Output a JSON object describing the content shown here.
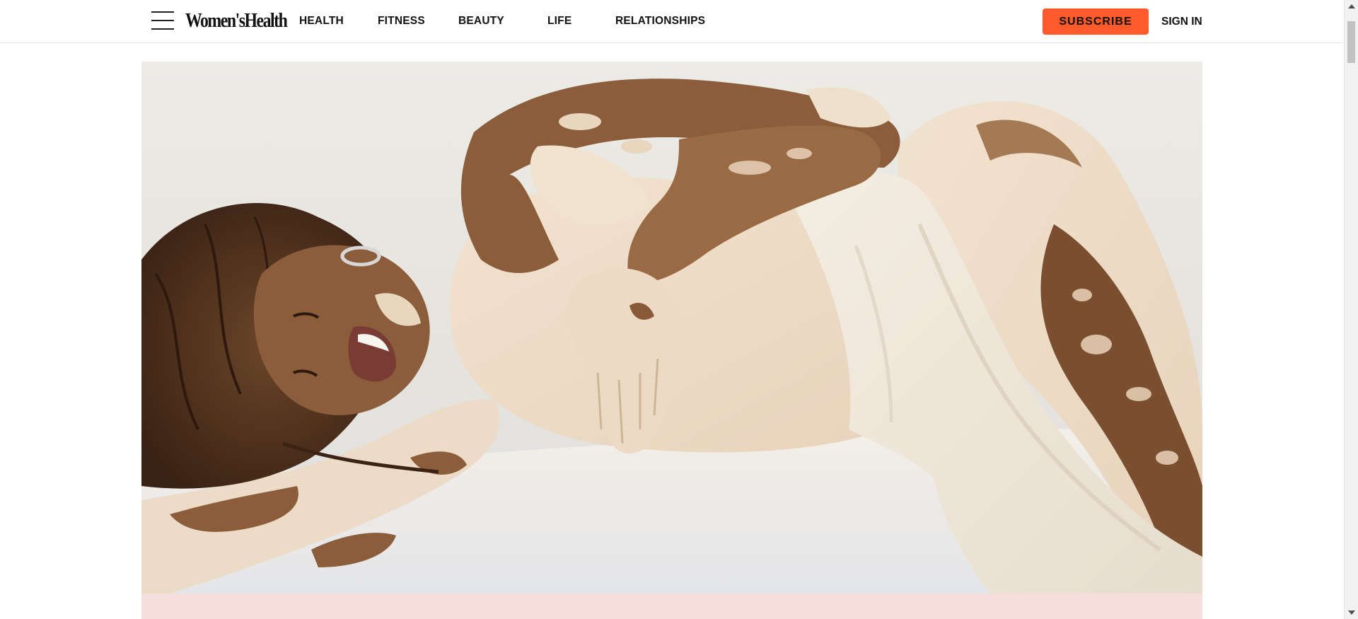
{
  "brand": {
    "logo_text": "Women'sHealth",
    "accent_color": "#ff5a2c"
  },
  "header": {
    "menu_icon": "hamburger-menu-icon",
    "nav": [
      {
        "label": "HEALTH"
      },
      {
        "label": "FITNESS"
      },
      {
        "label": "BEAUTY"
      },
      {
        "label": "LIFE"
      },
      {
        "label": "RELATIONSHIPS"
      }
    ],
    "subscribe_label": "SUBSCRIBE",
    "sign_in_label": "SIGN IN"
  },
  "hero": {
    "image_alt": "photo of woman with vitiligo reclining on a white surface"
  },
  "band_color": "#f5dedb"
}
